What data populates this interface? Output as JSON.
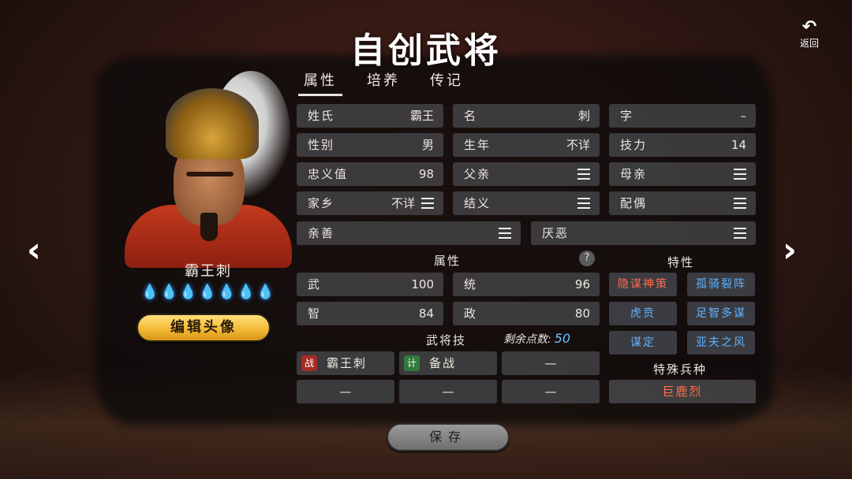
{
  "page": {
    "title": "自创武将",
    "back_icon": "↶",
    "back_label": "返回",
    "nav_prev_icon": "‹",
    "nav_next_icon": "›"
  },
  "hero": {
    "name": "霸王刺",
    "stars": "💧💧💧💧💧💧💧",
    "edit_avatar_label": "编辑头像"
  },
  "tabs": [
    {
      "label": "属性",
      "active": true
    },
    {
      "label": "培养",
      "active": false
    },
    {
      "label": "传记",
      "active": false
    }
  ],
  "info": {
    "surname": {
      "label": "姓氏",
      "value": "霸王"
    },
    "given_name": {
      "label": "名",
      "value": "刺"
    },
    "courtesy": {
      "label": "字",
      "value": "–"
    },
    "gender": {
      "label": "性别",
      "value": "男"
    },
    "birth_year": {
      "label": "生年",
      "value": "不详"
    },
    "skill_power": {
      "label": "技力",
      "value": "14"
    },
    "loyalty": {
      "label": "忠义值",
      "value": "98"
    },
    "father": {
      "label": "父亲"
    },
    "mother": {
      "label": "母亲"
    },
    "hometown": {
      "label": "家乡",
      "value": "不详"
    },
    "sworn": {
      "label": "结义"
    },
    "spouse": {
      "label": "配偶"
    },
    "likes": {
      "label": "亲善"
    },
    "dislikes": {
      "label": "厌恶"
    }
  },
  "attributes": {
    "header": "属性",
    "help": "?",
    "war": {
      "label": "武",
      "value": "100"
    },
    "command": {
      "label": "统",
      "value": "96"
    },
    "intellect": {
      "label": "智",
      "value": "84"
    },
    "politics": {
      "label": "政",
      "value": "80"
    }
  },
  "traits": {
    "header": "特性",
    "items": [
      {
        "label": "隐谋神策",
        "color": "#ff6d4a"
      },
      {
        "label": "孤骑裂阵",
        "color": "#5fb3ff"
      },
      {
        "label": "虎贲",
        "color": "#5fb3ff"
      },
      {
        "label": "足智多谋",
        "color": "#5fb3ff"
      },
      {
        "label": "谋定",
        "color": "#5fb3ff"
      },
      {
        "label": "亚夫之风",
        "color": "#5fb3ff"
      }
    ]
  },
  "skills": {
    "header": "武将技",
    "remaining_label": "剩余点数:",
    "remaining_value": "50",
    "slots": [
      {
        "tag": "战",
        "name": "霸王刺"
      },
      {
        "tag": "计",
        "name": "备战"
      },
      {
        "name": "—"
      },
      {
        "name": "—"
      },
      {
        "name": "—"
      },
      {
        "name": "—"
      }
    ]
  },
  "special_troop": {
    "header": "特殊兵种",
    "value": "巨鹿烈"
  },
  "save_label": "保存",
  "colors": {
    "accent_gold": "#f1b733",
    "red_text": "#ff6d4a",
    "blue_text": "#5fb3ff"
  }
}
